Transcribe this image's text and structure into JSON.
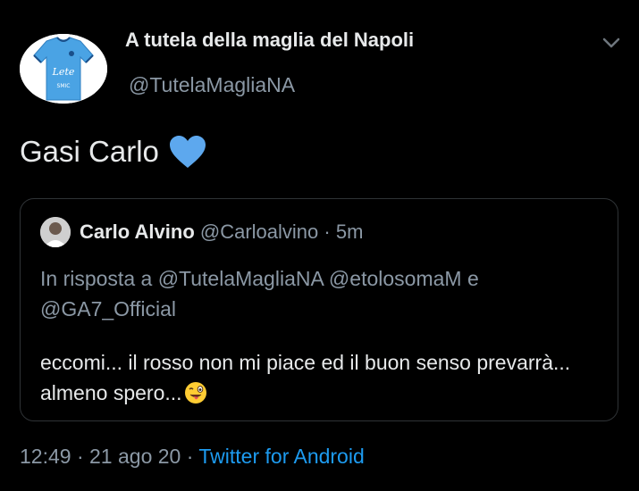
{
  "author": {
    "display_name": "A tutela della maglia del Napoli",
    "handle": "@TutelaMagliaNA",
    "avatar_icon": "napoli-jersey-icon",
    "jersey_text": "Lete",
    "jersey_sponsor": "SMIC"
  },
  "tweet": {
    "text": "Gasi Carlo",
    "emoji_icon": "blue-heart-icon"
  },
  "quoted": {
    "author_name": "Carlo Alvino",
    "author_handle": "@Carloalvino",
    "separator": "·",
    "time": "5m",
    "reply_prefix": "In risposta a",
    "reply_mentions": "@TutelaMagliaNA @etolosomaM e @GA7_Official",
    "text": "eccomi... il rosso non mi piace ed il buon senso prevarrà... almeno spero...",
    "emoji_icon": "winking-tongue-face-icon"
  },
  "footer": {
    "time": "12:49",
    "sep1": "·",
    "date": "21 ago 20",
    "sep2": "·",
    "source": "Twitter for Android"
  },
  "colors": {
    "background": "#000000",
    "text": "#e7e9ea",
    "muted": "#8b98a5",
    "link": "#1d9bf0",
    "heart": "#5da8ee",
    "border": "#2f3336"
  }
}
